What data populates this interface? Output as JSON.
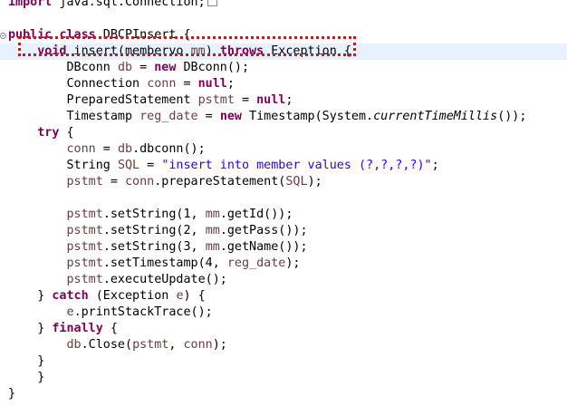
{
  "editor": {
    "lines": [
      {
        "id": "line-0",
        "segments": [
          {
            "t": "import",
            "c": "kw"
          },
          {
            "t": " java.sql.Connection;",
            "c": ""
          }
        ]
      },
      {
        "id": "line-1",
        "segments": []
      },
      {
        "id": "line-2",
        "segments": [
          {
            "t": "public",
            "c": "kw"
          },
          {
            "t": " ",
            "c": ""
          },
          {
            "t": "class",
            "c": "kw"
          },
          {
            "t": " DBCPInsert {",
            "c": ""
          }
        ]
      },
      {
        "id": "line-3",
        "current": true,
        "segments": [
          {
            "t": "    ",
            "c": ""
          },
          {
            "t": "void",
            "c": "kw"
          },
          {
            "t": " insert(membervo ",
            "c": ""
          },
          {
            "t": "mm",
            "c": "var"
          },
          {
            "t": ") ",
            "c": ""
          },
          {
            "t": "throws",
            "c": "kw"
          },
          {
            "t": " Exception {",
            "c": ""
          }
        ]
      },
      {
        "id": "line-4",
        "segments": [
          {
            "t": "        DBconn ",
            "c": ""
          },
          {
            "t": "db",
            "c": "var"
          },
          {
            "t": " = ",
            "c": ""
          },
          {
            "t": "new",
            "c": "kw"
          },
          {
            "t": " DBconn();",
            "c": ""
          }
        ]
      },
      {
        "id": "line-5",
        "segments": [
          {
            "t": "        Connection ",
            "c": ""
          },
          {
            "t": "conn",
            "c": "var"
          },
          {
            "t": " = ",
            "c": ""
          },
          {
            "t": "null",
            "c": "kw"
          },
          {
            "t": ";",
            "c": ""
          }
        ]
      },
      {
        "id": "line-6",
        "segments": [
          {
            "t": "        PreparedStatement ",
            "c": ""
          },
          {
            "t": "pstmt",
            "c": "var"
          },
          {
            "t": " = ",
            "c": ""
          },
          {
            "t": "null",
            "c": "kw"
          },
          {
            "t": ";",
            "c": ""
          }
        ]
      },
      {
        "id": "line-7",
        "segments": [
          {
            "t": "        Timestamp ",
            "c": ""
          },
          {
            "t": "reg_date",
            "c": "var"
          },
          {
            "t": " = ",
            "c": ""
          },
          {
            "t": "new",
            "c": "kw"
          },
          {
            "t": " Timestamp(System.",
            "c": ""
          },
          {
            "t": "currentTimeMillis",
            "c": "static-m"
          },
          {
            "t": "());",
            "c": ""
          }
        ]
      },
      {
        "id": "line-8",
        "segments": [
          {
            "t": "    ",
            "c": ""
          },
          {
            "t": "try",
            "c": "kw"
          },
          {
            "t": " {",
            "c": ""
          }
        ]
      },
      {
        "id": "line-9",
        "segments": [
          {
            "t": "        ",
            "c": ""
          },
          {
            "t": "conn",
            "c": "var"
          },
          {
            "t": " = ",
            "c": ""
          },
          {
            "t": "db",
            "c": "var"
          },
          {
            "t": ".dbconn();",
            "c": ""
          }
        ]
      },
      {
        "id": "line-10",
        "segments": [
          {
            "t": "        String ",
            "c": ""
          },
          {
            "t": "SQL",
            "c": "var"
          },
          {
            "t": " = ",
            "c": ""
          },
          {
            "t": "\"insert into member values (?,?,?,?)\"",
            "c": "str"
          },
          {
            "t": ";",
            "c": ""
          }
        ]
      },
      {
        "id": "line-11",
        "segments": [
          {
            "t": "        ",
            "c": ""
          },
          {
            "t": "pstmt",
            "c": "var"
          },
          {
            "t": " = ",
            "c": ""
          },
          {
            "t": "conn",
            "c": "var"
          },
          {
            "t": ".prepareStatement(",
            "c": ""
          },
          {
            "t": "SQL",
            "c": "var"
          },
          {
            "t": ");",
            "c": ""
          }
        ]
      },
      {
        "id": "line-12",
        "segments": []
      },
      {
        "id": "line-13",
        "segments": [
          {
            "t": "        ",
            "c": ""
          },
          {
            "t": "pstmt",
            "c": "var"
          },
          {
            "t": ".setString(1, ",
            "c": ""
          },
          {
            "t": "mm",
            "c": "var"
          },
          {
            "t": ".getId());",
            "c": ""
          }
        ]
      },
      {
        "id": "line-14",
        "segments": [
          {
            "t": "        ",
            "c": ""
          },
          {
            "t": "pstmt",
            "c": "var"
          },
          {
            "t": ".setString(2, ",
            "c": ""
          },
          {
            "t": "mm",
            "c": "var"
          },
          {
            "t": ".getPass());",
            "c": ""
          }
        ]
      },
      {
        "id": "line-15",
        "segments": [
          {
            "t": "        ",
            "c": ""
          },
          {
            "t": "pstmt",
            "c": "var"
          },
          {
            "t": ".setString(3, ",
            "c": ""
          },
          {
            "t": "mm",
            "c": "var"
          },
          {
            "t": ".getName());",
            "c": ""
          }
        ]
      },
      {
        "id": "line-16",
        "segments": [
          {
            "t": "        ",
            "c": ""
          },
          {
            "t": "pstmt",
            "c": "var"
          },
          {
            "t": ".setTimestamp(4, ",
            "c": ""
          },
          {
            "t": "reg_date",
            "c": "var"
          },
          {
            "t": ");",
            "c": ""
          }
        ]
      },
      {
        "id": "line-17",
        "segments": [
          {
            "t": "        ",
            "c": ""
          },
          {
            "t": "pstmt",
            "c": "var"
          },
          {
            "t": ".executeUpdate();",
            "c": ""
          }
        ]
      },
      {
        "id": "line-18",
        "segments": [
          {
            "t": "    } ",
            "c": ""
          },
          {
            "t": "catch",
            "c": "kw"
          },
          {
            "t": " (Exception ",
            "c": ""
          },
          {
            "t": "e",
            "c": "var"
          },
          {
            "t": ") {",
            "c": ""
          }
        ]
      },
      {
        "id": "line-19",
        "segments": [
          {
            "t": "        ",
            "c": ""
          },
          {
            "t": "e",
            "c": "var"
          },
          {
            "t": ".printStackTrace();",
            "c": ""
          }
        ]
      },
      {
        "id": "line-20",
        "segments": [
          {
            "t": "    } ",
            "c": ""
          },
          {
            "t": "finally",
            "c": "kw"
          },
          {
            "t": " {",
            "c": ""
          }
        ]
      },
      {
        "id": "line-21",
        "segments": [
          {
            "t": "        ",
            "c": ""
          },
          {
            "t": "db",
            "c": "var"
          },
          {
            "t": ".Close(",
            "c": ""
          },
          {
            "t": "pstmt",
            "c": "var"
          },
          {
            "t": ", ",
            "c": ""
          },
          {
            "t": "conn",
            "c": "var"
          },
          {
            "t": ");",
            "c": ""
          }
        ]
      },
      {
        "id": "line-22",
        "segments": [
          {
            "t": "    }",
            "c": ""
          }
        ]
      },
      {
        "id": "line-23",
        "segments": [
          {
            "t": "    }",
            "c": ""
          }
        ]
      },
      {
        "id": "line-24",
        "segments": [
          {
            "t": "}",
            "c": ""
          }
        ]
      }
    ]
  },
  "colors": {
    "keyword": "#7f0055",
    "string": "#2a00ff",
    "local_variable": "#6a3e3e",
    "current_line": "#e8f2fe",
    "annotation_box": "#d4131b"
  }
}
